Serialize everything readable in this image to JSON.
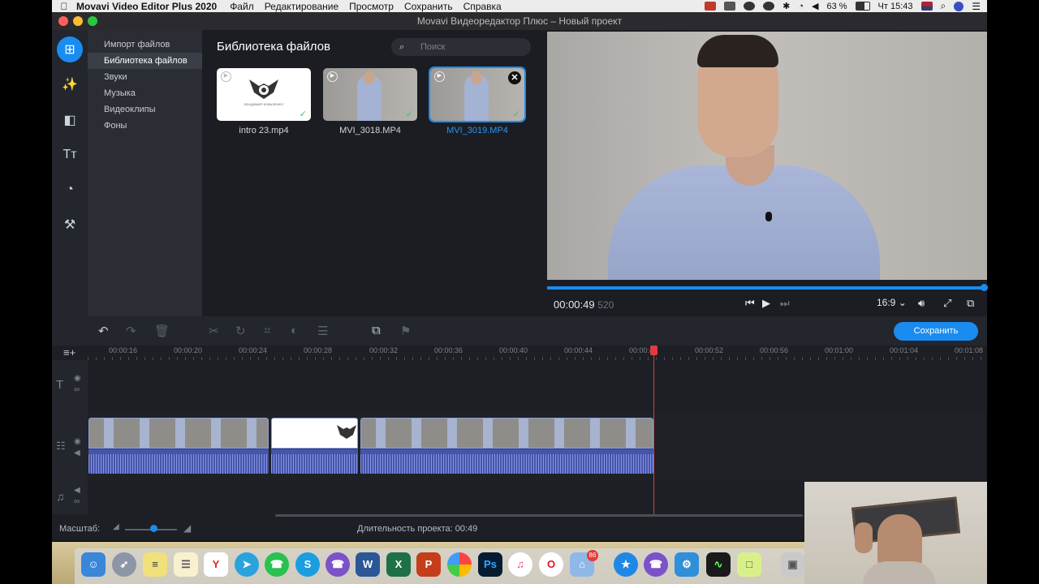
{
  "menubar": {
    "app_name": "Movavi Video Editor Plus 2020",
    "items": [
      "Файл",
      "Редактирование",
      "Просмотр",
      "Сохранить",
      "Справка"
    ],
    "battery": "63 %",
    "clock": "Чт 15:43"
  },
  "window": {
    "title": "Movavi Видеоредактор Плюс – Новый проект"
  },
  "sidebar": {
    "icons": [
      "import-icon",
      "magic-wand-icon",
      "transitions-icon",
      "titles-icon",
      "stickers-icon",
      "tools-icon"
    ],
    "categories": [
      "Импорт файлов",
      "Библиотека файлов",
      "Звуки",
      "Музыка",
      "Видеоклипы",
      "Фоны"
    ],
    "selected_category": "Библиотека файлов"
  },
  "library": {
    "title": "Библиотека файлов",
    "search_placeholder": "Поиск",
    "files": [
      {
        "name": "intro 23.mp4",
        "selected": false
      },
      {
        "name": "MVI_3018.MP4",
        "selected": false
      },
      {
        "name": "MVI_3019.MP4",
        "selected": true
      }
    ],
    "intro_thumb_caption": "ВЛАДИМИР КОВАЛЕНКО"
  },
  "preview": {
    "timecode": "00:00:49",
    "timecode_ms": "520",
    "progress": 1.0,
    "aspect": "16:9"
  },
  "toolbar": {
    "save_label": "Сохранить"
  },
  "timeline": {
    "ticks": [
      "00:00:16",
      "00:00:20",
      "00:00:24",
      "00:00:28",
      "00:00:32",
      "00:00:36",
      "00:00:40",
      "00:00:44",
      "00:00:48",
      "00:00:52",
      "00:00:56",
      "00:01:00",
      "00:01:04",
      "00:01:08"
    ]
  },
  "footer": {
    "zoom_label": "Масштаб:",
    "zoom_level": 0.55,
    "duration_label": "Длительность проекта:",
    "duration_value": "00:49"
  },
  "dock": {
    "apps": [
      "Finder",
      "Launchpad",
      "Stickies",
      "Notes",
      "Yandex",
      "Telegram",
      "WhatsApp",
      "Skype",
      "Viber",
      "Word",
      "Excel",
      "PowerPoint",
      "Photos",
      "Photoshop",
      "iTunes",
      "Opera",
      "Preview",
      "Safari",
      "Viber",
      "Movavi",
      "Activity Monitor",
      "Notes",
      "Screenshot"
    ],
    "badge": "86"
  }
}
